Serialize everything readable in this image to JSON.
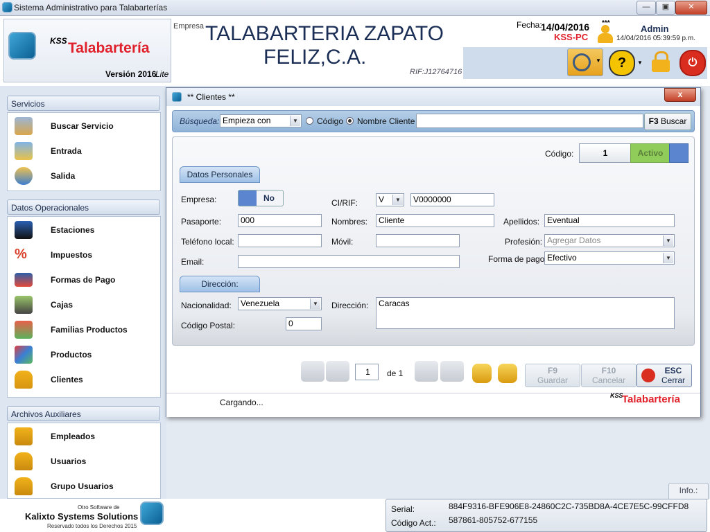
{
  "window": {
    "title": "Sistema Administrativo para Talabarterías"
  },
  "header": {
    "brand_prefix": "KSS",
    "brand_name": "Talabartería",
    "version_label": "Versión 2016",
    "version_edition": "Lite",
    "company_label": "Empresa",
    "company_line1": "TALABARTERIA ZAPATO",
    "company_line2": "FELIZ,C.A.",
    "rif": "RIF:J12764716",
    "date_label": "Fecha:",
    "date_value": "14/04/2016",
    "pc_name": "KSS-PC",
    "user_name": "Admin",
    "user_stars": "***",
    "datetime": "14/04/2016 05:39:59 p.m."
  },
  "sidebar": {
    "sections": [
      {
        "title": "Servicios",
        "items": [
          "Buscar Servicio",
          "Entrada",
          "Salida"
        ]
      },
      {
        "title": "Datos Operacionales",
        "items": [
          "Estaciones",
          "Impuestos",
          "Formas de Pago",
          "Cajas",
          "Familias Productos",
          "Productos",
          "Clientes"
        ]
      },
      {
        "title": "Archivos Auxiliares",
        "items": [
          "Empleados",
          "Usuarios",
          "Grupo Usuarios"
        ]
      }
    ],
    "footer_small": "Otro Software de",
    "footer_company": "Kalixto Systems Solutions",
    "footer_rights": "Reservado todos los Derechos 2015"
  },
  "dialog": {
    "title": "** Clientes **",
    "close_label": "x",
    "search": {
      "label": "Búsqueda:",
      "mode": "Empieza con",
      "option_code": "Código",
      "option_name": "Nombre Cliente",
      "selected": "Nombre Cliente",
      "value": "",
      "button_key": "F3",
      "button_label": "Buscar"
    },
    "code_label": "Código:",
    "code_value": "1",
    "status": "Activo",
    "personal_tab": "Datos Personales",
    "empresa_label": "Empresa:",
    "empresa_toggle": "No",
    "cirif_label": "CI/RIF:",
    "cirif_type": "V",
    "cirif_value": "V0000000",
    "pasaporte_label": "Pasaporte:",
    "pasaporte_value": "000",
    "nombres_label": "Nombres:",
    "nombres_value": "Cliente",
    "apellidos_label": "Apellidos:",
    "apellidos_value": "Eventual",
    "telefono_label": "Teléfono local:",
    "telefono_value": "",
    "movil_label": "Móvil:",
    "movil_value": "",
    "profesion_label": "Profesión:",
    "profesion_value": "Agregar Datos",
    "email_label": "Email:",
    "email_value": "",
    "forma_pago_label": "Forma de pago:",
    "forma_pago_value": "Efectivo",
    "direccion_tab": "Dirección:",
    "nacionalidad_label": "Nacionalidad:",
    "nacionalidad_value": "Venezuela",
    "direccion_label": "Dirección:",
    "direccion_value": "Caracas",
    "codigo_postal_label": "Código Postal:",
    "codigo_postal_value": "0",
    "pager": {
      "page": "1",
      "of_label": "de 1"
    },
    "buttons": {
      "guardar_key": "F9",
      "guardar_label": "Guardar",
      "cancelar_key": "F10",
      "cancelar_label": "Cancelar",
      "cerrar_key": "ESC",
      "cerrar_label": "Cerrar"
    },
    "status_text": "Cargando...",
    "brand_prefix": "KSS",
    "brand_name": "Talabartería"
  },
  "bottom": {
    "info_tab": "Info.:",
    "serial_label": "Serial:",
    "serial_value": "884F9316-BFE906E8-24860C2C-735BD8A-4CE7E5C-99CFFD8",
    "codigo_act_label": "Código Act.:",
    "codigo_act_value": "587861-805752-677155"
  },
  "colors": {
    "brand_red": "#e0202a",
    "accent_blue": "#1a3f8f",
    "status_green": "#8fcc5a"
  }
}
